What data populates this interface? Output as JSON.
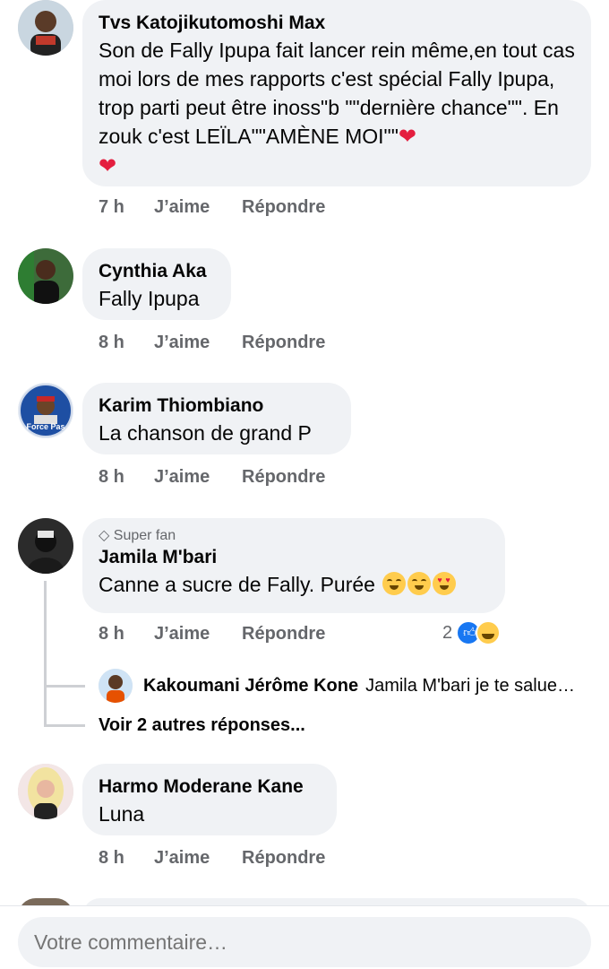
{
  "comments": [
    {
      "author": "Tvs Katojikutomoshi Max",
      "text": "Son de Fally Ipupa fait lancer rein même,en tout cas moi lors de mes rapports c'est spécial Fally Ipupa, trop parti peut être inoss\"b \"\"dernière chance\"\". En zouk c'est LEÏLA\"\"AMÈNE MOI\"\"",
      "time": "7 h",
      "like_label": "J’aime",
      "reply_label": "Répondre"
    },
    {
      "author": "Cynthia Aka",
      "text": "Fally Ipupa",
      "time": "8 h",
      "like_label": "J’aime",
      "reply_label": "Répondre"
    },
    {
      "author": "Karim Thiombiano",
      "text": "La chanson de grand P",
      "time": "8 h",
      "like_label": "J’aime",
      "reply_label": "Répondre",
      "avatar_caption": "Force Pas"
    },
    {
      "badge": "Super fan",
      "author": "Jamila M'bari",
      "text": "Canne a sucre de Fally. Purée",
      "time": "8 h",
      "like_label": "J’aime",
      "reply_label": "Répondre",
      "reaction_count": "2",
      "reactions": [
        "like-icon",
        "haha-icon"
      ],
      "reply_preview": {
        "author": "Kakoumani Jérôme Kone",
        "text": "Jamila M'bari je te salue…"
      },
      "more_replies": "Voir 2 autres réponses..."
    },
    {
      "author": "Harmo Moderane Kane",
      "text": "Luna",
      "time": "8 h",
      "like_label": "J’aime",
      "reply_label": "Répondre"
    }
  ],
  "composer": {
    "placeholder": "Votre commentaire…"
  },
  "colors": {
    "bubble": "#f0f2f5",
    "secondary_text": "#65676b",
    "heart": "#e41e3f",
    "like_blue": "#1877f2"
  }
}
